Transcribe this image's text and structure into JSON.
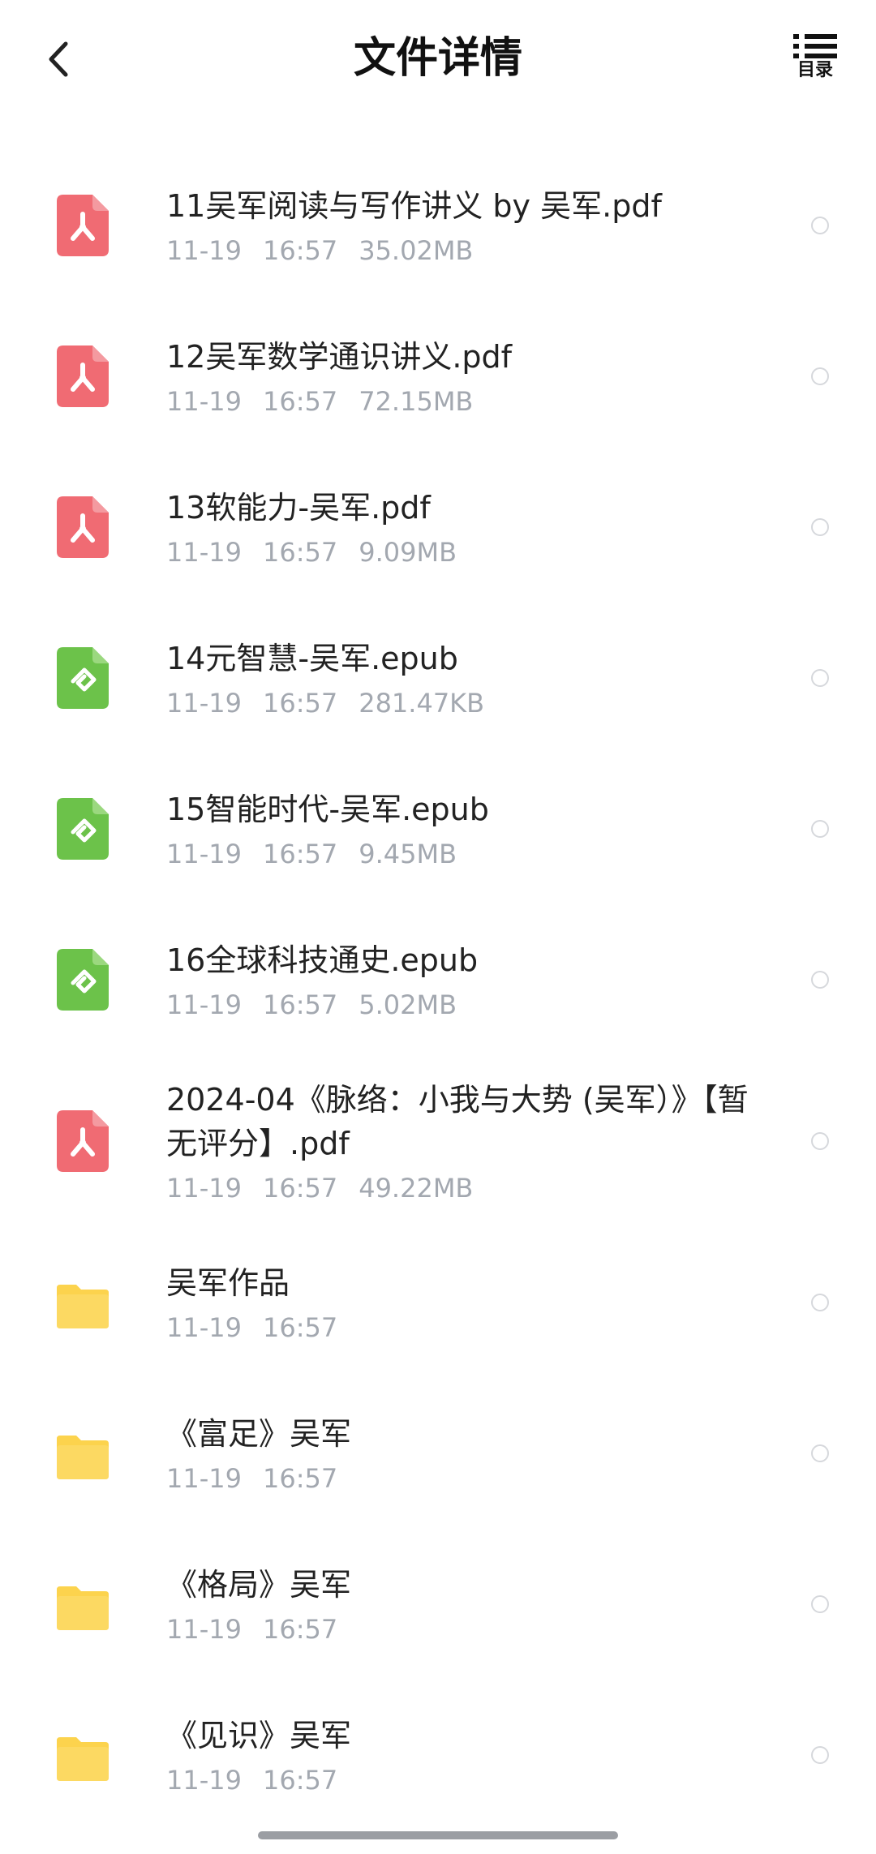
{
  "header": {
    "title": "文件详情",
    "toc_label": "目录"
  },
  "colors": {
    "pdf": "#f06b73",
    "epub": "#6cc24a",
    "folder": "#fcd34d",
    "meta": "#a3a8b0"
  },
  "files": [
    {
      "name": "11吴军阅读与写作讲义 by 吴军.pdf",
      "date": "11-19",
      "time": "16:57",
      "size": "35.02MB",
      "icon": "pdf-icon"
    },
    {
      "name": "12吴军数学通识讲义.pdf",
      "date": "11-19",
      "time": "16:57",
      "size": "72.15MB",
      "icon": "pdf-icon"
    },
    {
      "name": "13软能力-吴军.pdf",
      "date": "11-19",
      "time": "16:57",
      "size": "9.09MB",
      "icon": "pdf-icon"
    },
    {
      "name": "14元智慧-吴军.epub",
      "date": "11-19",
      "time": "16:57",
      "size": "281.47KB",
      "icon": "epub-icon"
    },
    {
      "name": "15智能时代-吴军.epub",
      "date": "11-19",
      "time": "16:57",
      "size": "9.45MB",
      "icon": "epub-icon"
    },
    {
      "name": "16全球科技通史.epub",
      "date": "11-19",
      "time": "16:57",
      "size": "5.02MB",
      "icon": "epub-icon"
    },
    {
      "name": "2024-04《脉络：小我与大势 (吴军）》【暂无评分】.pdf",
      "date": "11-19",
      "time": "16:57",
      "size": "49.22MB",
      "icon": "pdf-icon"
    },
    {
      "name": "吴军作品",
      "date": "11-19",
      "time": "16:57",
      "size": "",
      "icon": "folder-icon"
    },
    {
      "name": "《富足》吴军",
      "date": "11-19",
      "time": "16:57",
      "size": "",
      "icon": "folder-icon"
    },
    {
      "name": "《格局》吴军",
      "date": "11-19",
      "time": "16:57",
      "size": "",
      "icon": "folder-icon"
    },
    {
      "name": "《见识》吴军",
      "date": "11-19",
      "time": "16:57",
      "size": "",
      "icon": "folder-icon"
    }
  ]
}
